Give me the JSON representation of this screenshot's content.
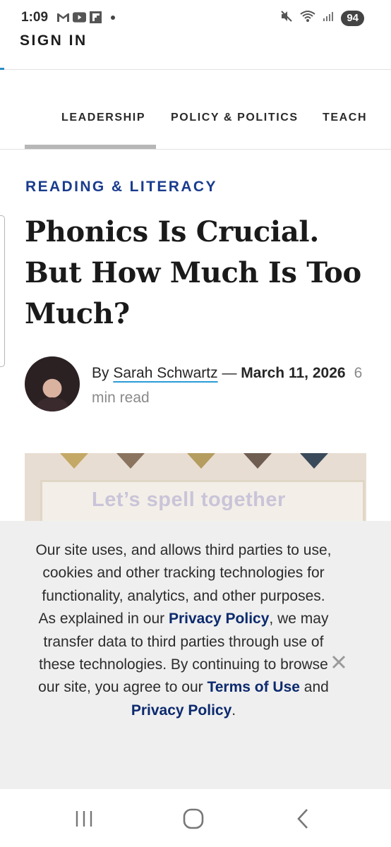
{
  "status_bar": {
    "time": "1:09",
    "icons": [
      "gmail-icon",
      "youtube-icon",
      "flipboard-icon",
      "notification-dot"
    ],
    "right_icons": [
      "mute-icon",
      "wifi-icon",
      "signal-icon"
    ],
    "battery": "94"
  },
  "header": {
    "sign_in": "SIGN IN",
    "accent_color": "#2b8cc4"
  },
  "nav": {
    "items": [
      {
        "label": "LEADERSHIP"
      },
      {
        "label": "POLICY & POLITICS"
      },
      {
        "label": "TEACH"
      }
    ],
    "selected_index": 0
  },
  "article": {
    "category": "READING & LITERACY",
    "category_color": "#1a3c8e",
    "headline": "Phonics Is Crucial. But How Much Is Too Much?",
    "byline": {
      "by": "By",
      "author": "Sarah Schwartz",
      "separator": "—",
      "date": "March 11, 2026",
      "read_time": "6 min read"
    },
    "hero_image_text": "Let’s spell together"
  },
  "cookie_banner": {
    "part1": "Our site uses, and allows third parties to use, cookies and other tracking technologies for functionality, analytics, and other purposes. As explained in our ",
    "privacy_link_1": "Privacy Policy",
    "part2": ", we may transfer data to third parties through use of these technologies. By continuing to browse our site, you agree to our ",
    "terms_link": "Terms of Use",
    "part3": " and ",
    "privacy_link_2": "Privacy Policy",
    "part4": ".",
    "link_color": "#0c2a6e",
    "close_icon": "close-icon"
  },
  "system_nav": {
    "buttons": [
      "recents-icon",
      "home-icon",
      "back-icon"
    ]
  }
}
